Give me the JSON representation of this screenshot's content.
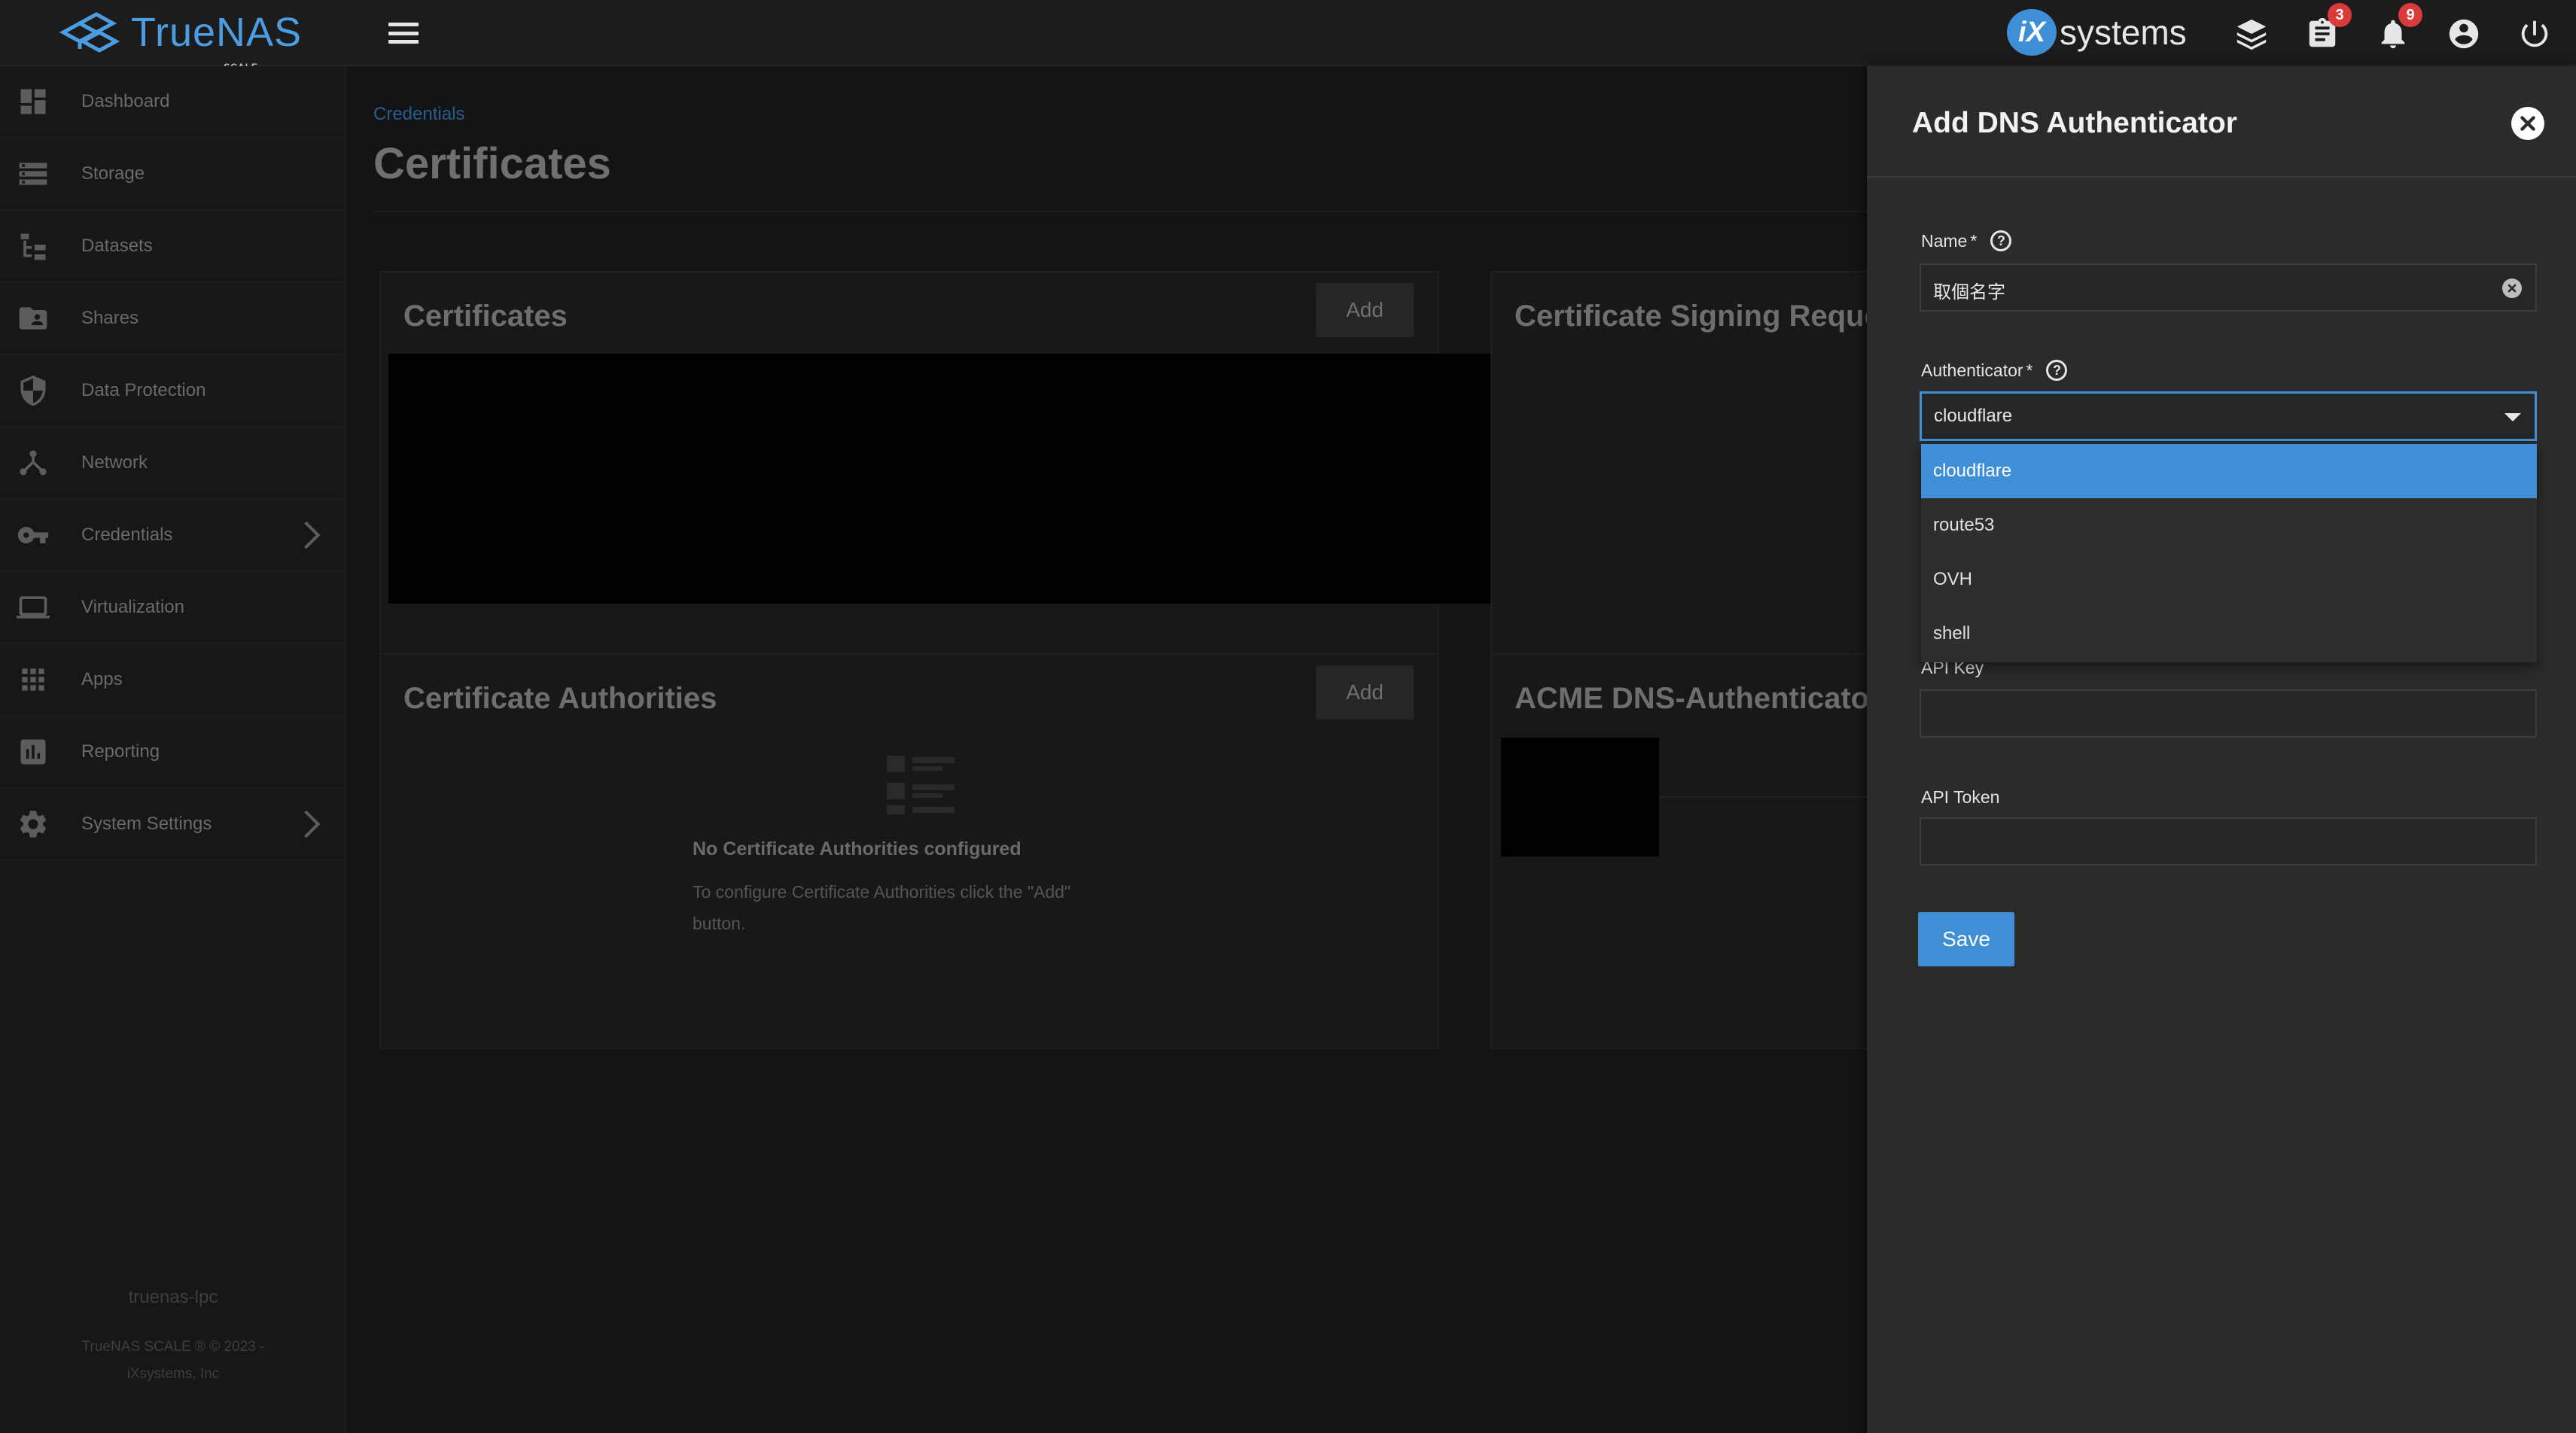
{
  "header": {
    "brand": "TrueNAS",
    "brand_sub": "SCALE",
    "vendor_logo_mark": "iX",
    "vendor_logo_text": "systems",
    "tasks_badge": "3",
    "alerts_badge": "9",
    "icons": [
      "menu-icon",
      "truecommand-icon",
      "jobs-icon",
      "notifications-icon",
      "account-icon",
      "power-icon"
    ]
  },
  "sidebar": {
    "items": [
      {
        "label": "Dashboard",
        "icon": "dashboard-icon"
      },
      {
        "label": "Storage",
        "icon": "storage-icon"
      },
      {
        "label": "Datasets",
        "icon": "datasets-icon"
      },
      {
        "label": "Shares",
        "icon": "shares-icon"
      },
      {
        "label": "Data Protection",
        "icon": "shield-icon"
      },
      {
        "label": "Network",
        "icon": "network-icon"
      },
      {
        "label": "Credentials",
        "icon": "key-icon"
      },
      {
        "label": "Virtualization",
        "icon": "laptop-icon"
      },
      {
        "label": "Apps",
        "icon": "apps-icon"
      },
      {
        "label": "Reporting",
        "icon": "reporting-icon"
      },
      {
        "label": "System Settings",
        "icon": "gear-icon"
      }
    ],
    "hostname": "truenas-lpc",
    "copyright_line1": "TrueNAS SCALE ® © 2023 -",
    "copyright_line2": "iXsystems, Inc"
  },
  "main": {
    "breadcrumb": "Credentials",
    "page_title": "Certificates",
    "cards": {
      "certificates": {
        "title": "Certificates",
        "add_label": "Add"
      },
      "csr": {
        "title": "Certificate Signing Requests"
      },
      "authorities": {
        "title": "Certificate Authorities",
        "add_label": "Add",
        "empty_title": "No Certificate Authorities configured",
        "empty_desc_line1": "To configure Certificate Authorities click the \"Add\"",
        "empty_desc_line2": "button."
      },
      "acme": {
        "title": "ACME DNS-Authenticators"
      }
    }
  },
  "panel": {
    "title": "Add DNS Authenticator",
    "name_label": "Name",
    "name_required": "*",
    "name_value": "取個名字",
    "authenticator_label": "Authenticator",
    "authenticator_required": "*",
    "authenticator_value": "cloudflare",
    "options": [
      "cloudflare",
      "route53",
      "OVH",
      "shell"
    ],
    "api_key_label": "API Key",
    "api_key_value": "",
    "api_token_label": "API Token",
    "api_token_value": "",
    "save_label": "Save",
    "accent_color": "#3f8fd6"
  }
}
